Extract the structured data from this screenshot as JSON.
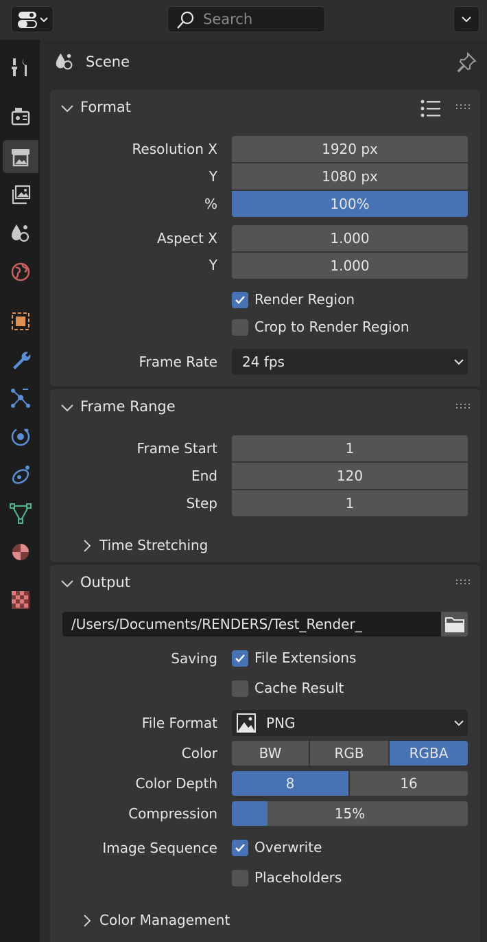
{
  "header": {
    "search_placeholder": "Search"
  },
  "sidebar": {
    "tabs": [
      {
        "icon": "tool-icon"
      },
      {
        "icon": "render-icon"
      },
      {
        "icon": "output-icon",
        "active": true
      },
      {
        "icon": "view-layer-icon"
      },
      {
        "icon": "scene-icon"
      },
      {
        "icon": "world-icon"
      },
      {
        "icon": "object-icon"
      },
      {
        "icon": "modifier-wrench-icon"
      },
      {
        "icon": "particles-icon"
      },
      {
        "icon": "physics-icon"
      },
      {
        "icon": "constraints-icon"
      },
      {
        "icon": "object-data-icon"
      },
      {
        "icon": "material-icon"
      },
      {
        "icon": "texture-icon"
      }
    ]
  },
  "context": {
    "label": "Scene"
  },
  "format": {
    "title": "Format",
    "resolution_x_label": "Resolution X",
    "resolution_x": "1920 px",
    "resolution_y_label": "Y",
    "resolution_y": "1080 px",
    "percent_label": "%",
    "percent": "100%",
    "aspect_x_label": "Aspect X",
    "aspect_x": "1.000",
    "aspect_y_label": "Y",
    "aspect_y": "1.000",
    "render_region": "Render Region",
    "crop_region": "Crop to Render Region",
    "frame_rate_label": "Frame Rate",
    "frame_rate": "24 fps"
  },
  "frame_range": {
    "title": "Frame Range",
    "start_label": "Frame Start",
    "start": "1",
    "end_label": "End",
    "end": "120",
    "step_label": "Step",
    "step": "1",
    "time_stretching": "Time Stretching"
  },
  "output": {
    "title": "Output",
    "path": "/Users/Documents/RENDERS/Test_Render_",
    "saving_label": "Saving",
    "file_extensions": "File Extensions",
    "cache_result": "Cache Result",
    "file_format_label": "File Format",
    "file_format": "PNG",
    "color_label": "Color",
    "color_options": [
      "BW",
      "RGB",
      "RGBA"
    ],
    "color_depth_label": "Color Depth",
    "color_depth_options": [
      "8",
      "16"
    ],
    "compression_label": "Compression",
    "compression": "15%",
    "compression_fraction": 0.15,
    "image_sequence_label": "Image Sequence",
    "overwrite": "Overwrite",
    "placeholders": "Placeholders",
    "color_management": "Color Management"
  },
  "colors": {
    "accent": "#4772b3",
    "panel": "#353535",
    "field": "#545454"
  }
}
